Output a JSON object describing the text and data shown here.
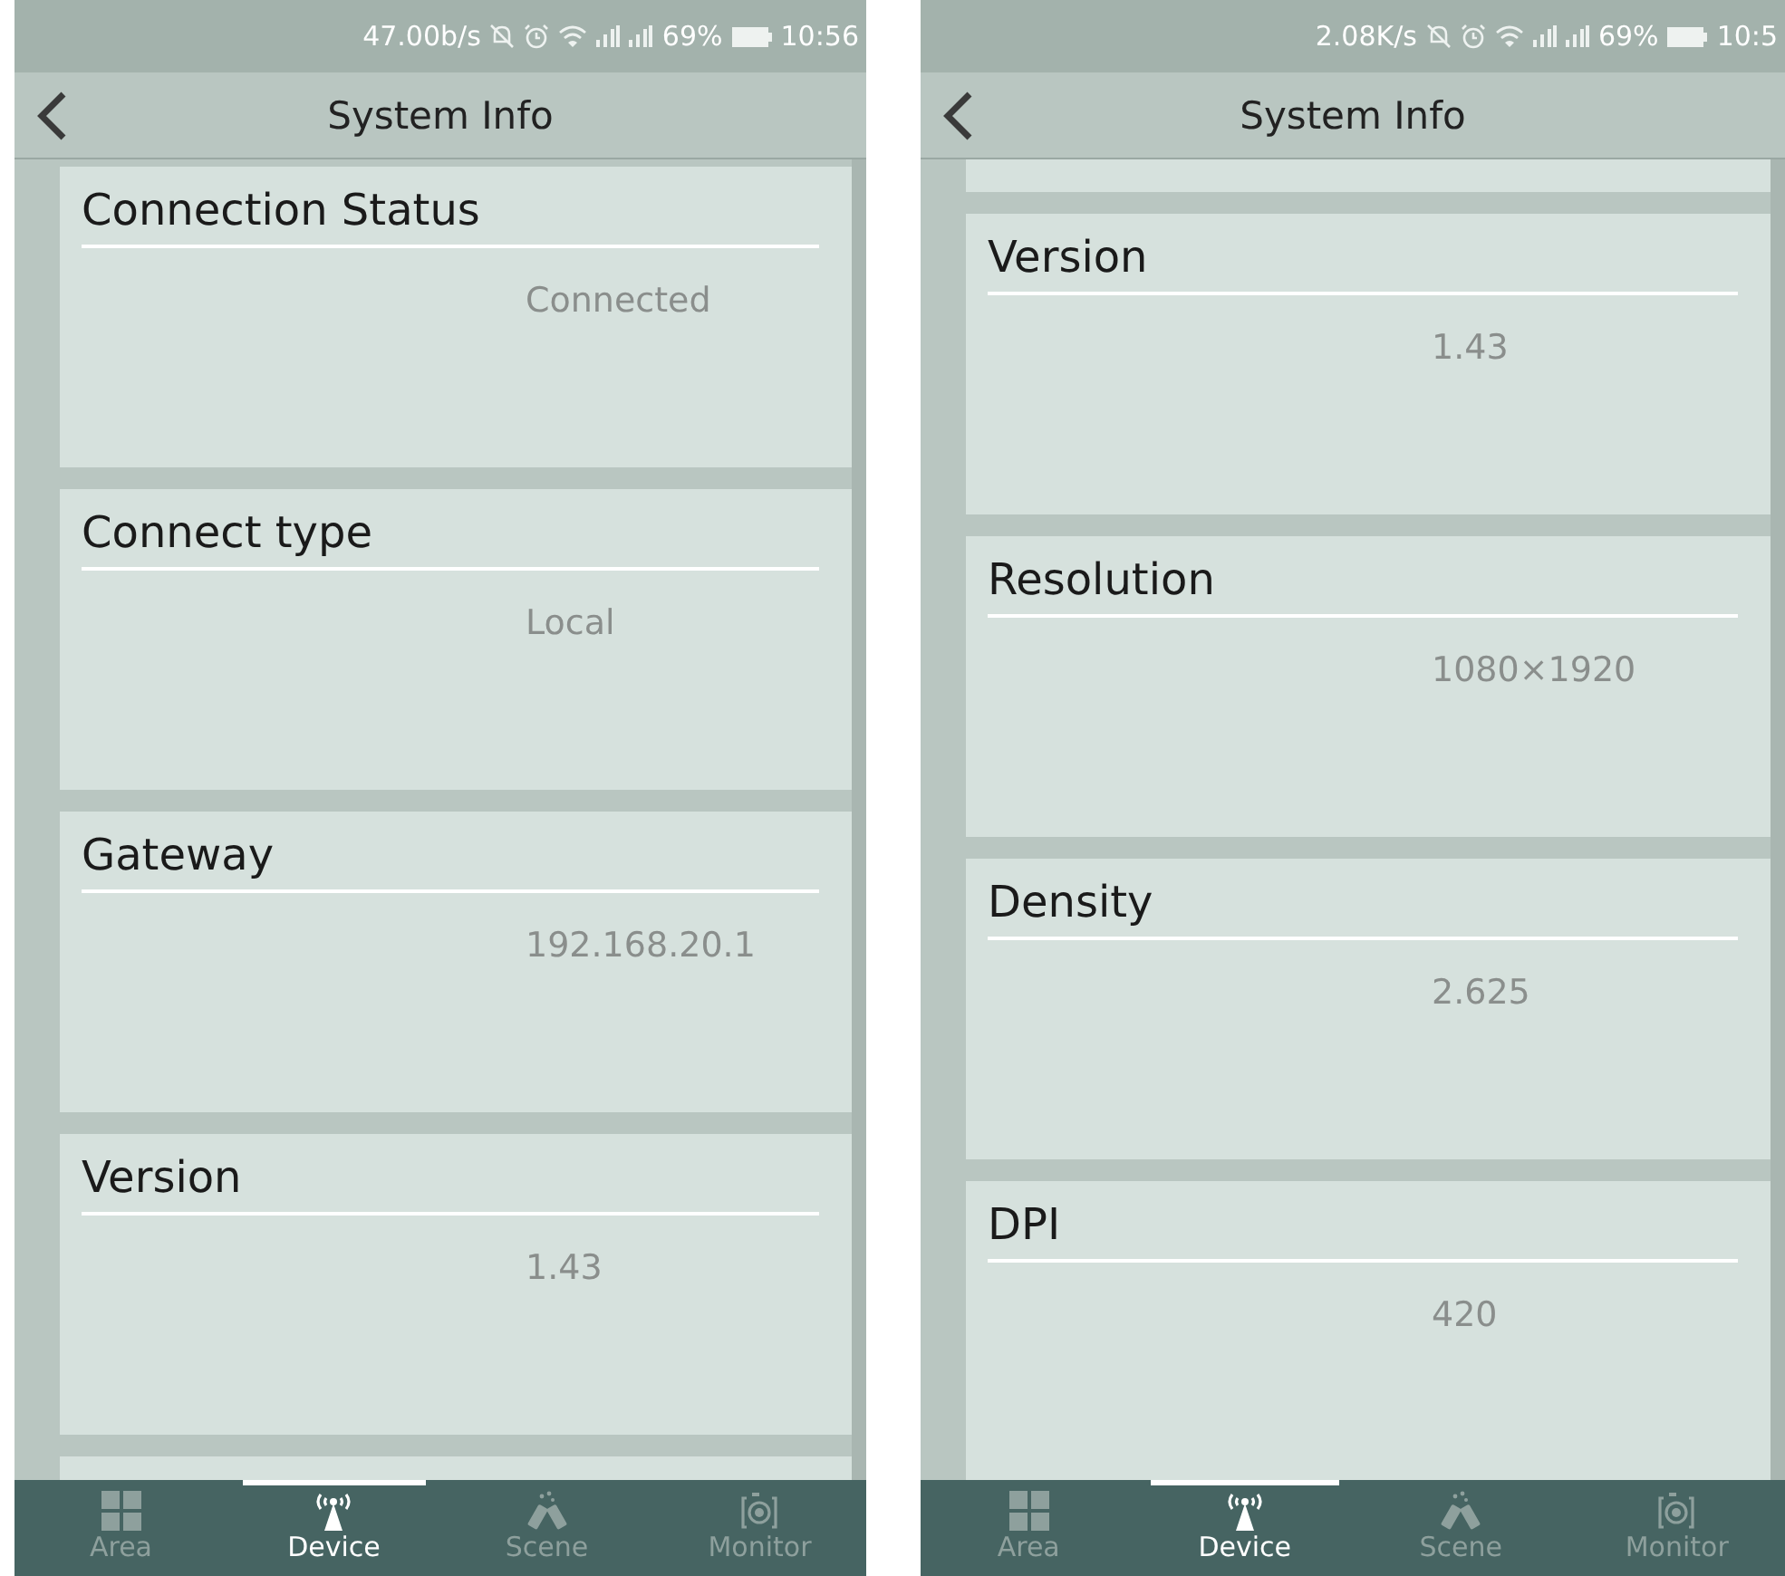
{
  "phones": [
    {
      "status": {
        "speed": "47.00b/s",
        "battery": "69%",
        "time": "10:56"
      },
      "title": "System Info",
      "partial_card_above": false,
      "partial_card_below": true,
      "cards": [
        {
          "label": "Connection Status",
          "value": "Connected"
        },
        {
          "label": "Connect type",
          "value": "Local"
        },
        {
          "label": "Gateway",
          "value": "192.168.20.1"
        },
        {
          "label": "Version",
          "value": "1.43"
        }
      ],
      "nav": [
        {
          "label": "Area",
          "kind": "grid",
          "selected": false
        },
        {
          "label": "Device",
          "kind": "antenna",
          "selected": true
        },
        {
          "label": "Scene",
          "kind": "scene",
          "selected": false
        },
        {
          "label": "Monitor",
          "kind": "camera",
          "selected": false
        }
      ]
    },
    {
      "status": {
        "speed": "2.08K/s",
        "battery": "69%",
        "time": "10:5"
      },
      "title": "System Info",
      "partial_card_above": true,
      "partial_card_below": false,
      "cards": [
        {
          "label": "Version",
          "value": "1.43"
        },
        {
          "label": "Resolution",
          "value": "1080×1920"
        },
        {
          "label": "Density",
          "value": "2.625"
        },
        {
          "label": "DPI",
          "value": "420"
        }
      ],
      "nav": [
        {
          "label": "Area",
          "kind": "grid",
          "selected": false
        },
        {
          "label": "Device",
          "kind": "antenna",
          "selected": true
        },
        {
          "label": "Scene",
          "kind": "scene",
          "selected": false
        },
        {
          "label": "Monitor",
          "kind": "camera",
          "selected": false
        }
      ]
    }
  ]
}
